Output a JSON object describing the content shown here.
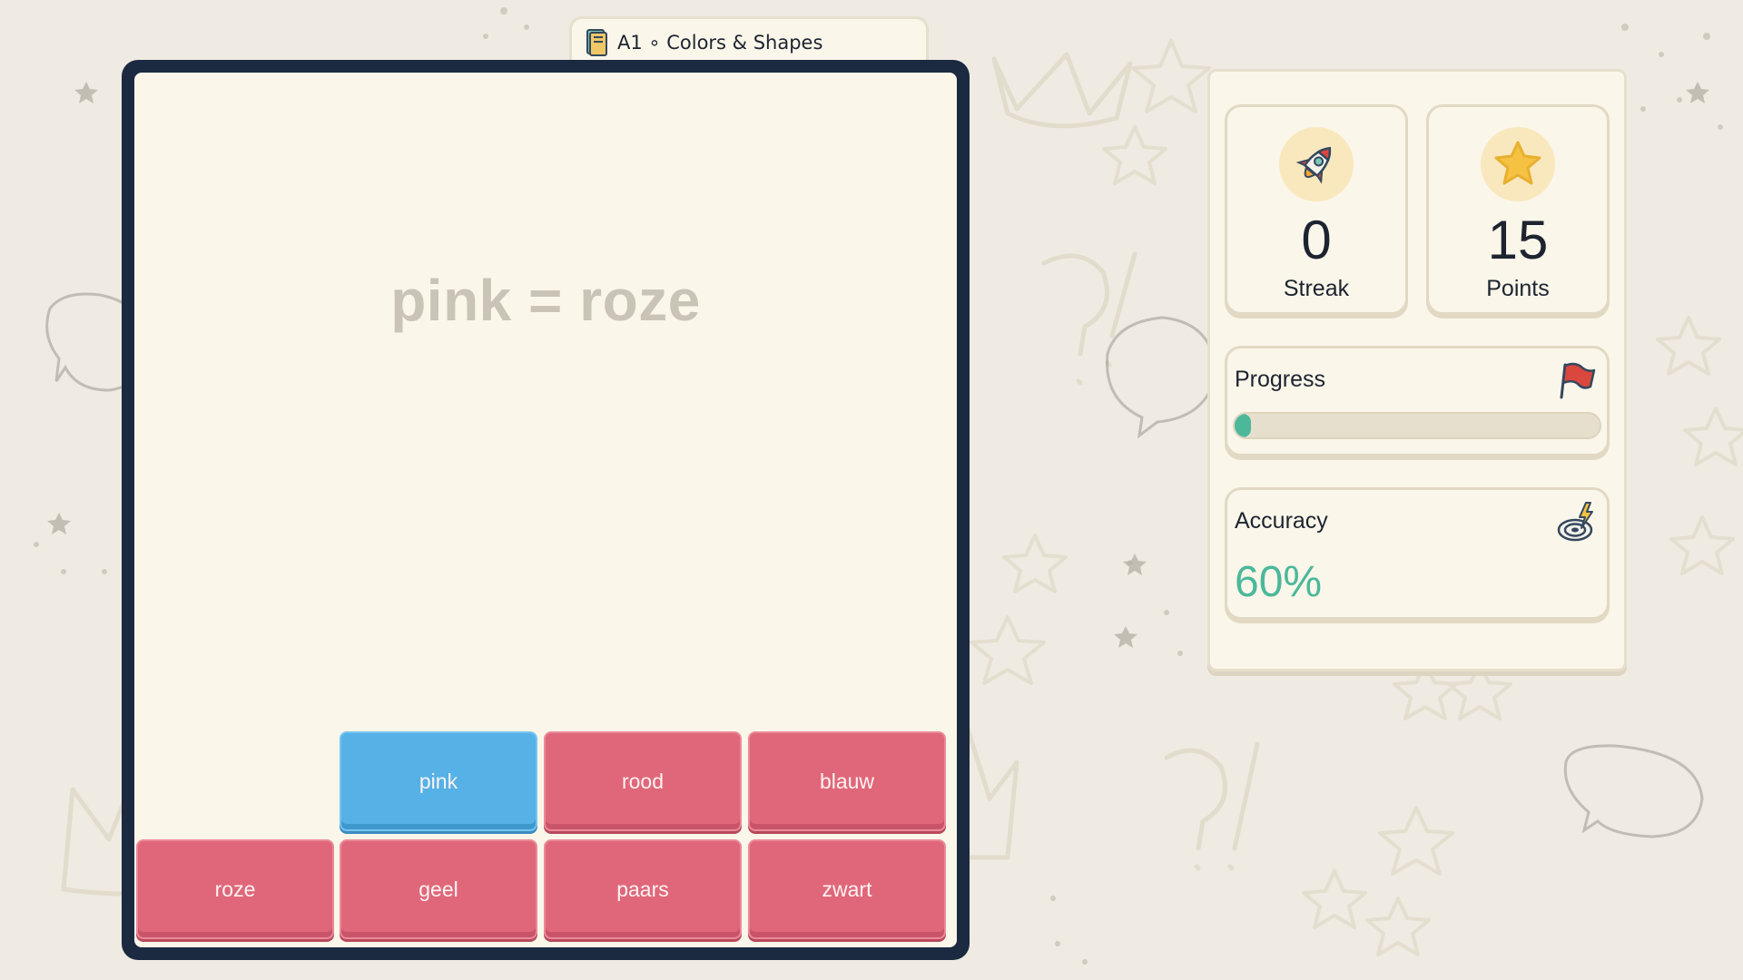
{
  "lesson": {
    "title": "A1 ∘ Colors & Shapes",
    "icon": "book-stack-icon"
  },
  "board": {
    "prompt": "pink = roze",
    "blocks_row1": [
      "pink",
      "rood",
      "blauw"
    ],
    "blocks_row2": [
      "roze",
      "geel",
      "paars",
      "zwart"
    ],
    "selected_block": "pink",
    "colors": {
      "frame": "#1b2a40",
      "block_red": "#e0677a",
      "block_blue": "#55b1e6"
    }
  },
  "stats": {
    "streak": {
      "value": "0",
      "label": "Streak",
      "icon": "rocket-icon"
    },
    "points": {
      "value": "15",
      "label": "Points",
      "icon": "star-icon"
    },
    "progress": {
      "label": "Progress",
      "icon": "flag-icon",
      "percent": 3
    },
    "accuracy": {
      "label": "Accuracy",
      "value": "60%",
      "icon": "target-icon",
      "color": "#4bb89a"
    }
  }
}
